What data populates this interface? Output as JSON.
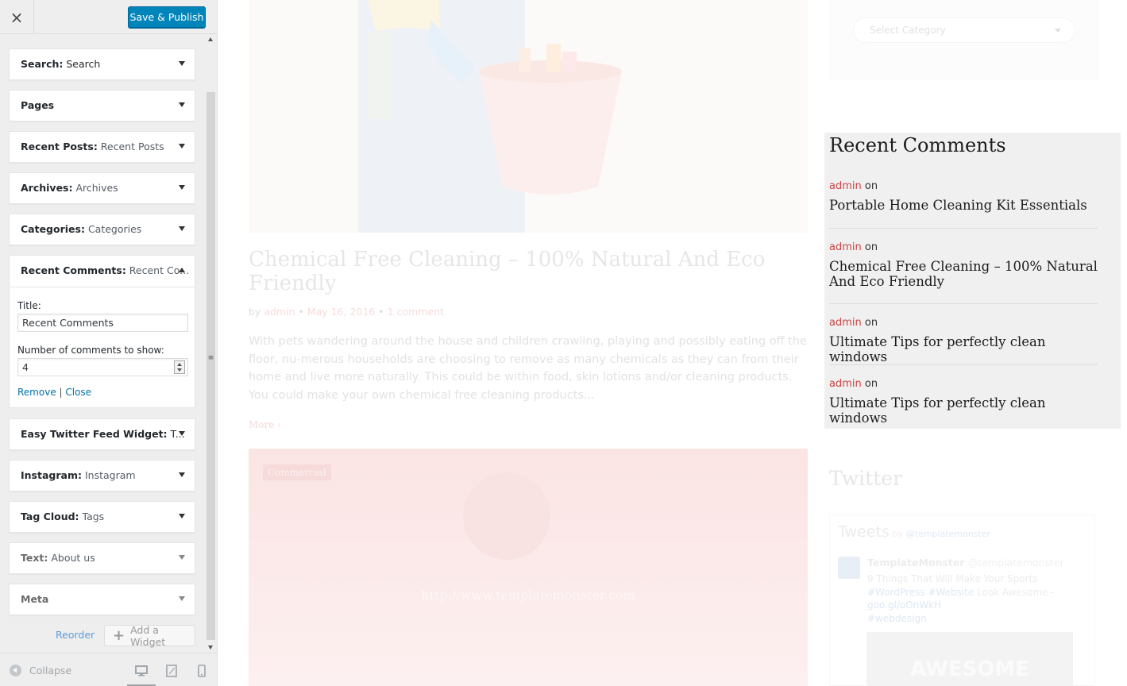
{
  "sidebar": {
    "close_icon": "×",
    "save_label": "Save & Publish",
    "widgets": [
      {
        "title": "Search:",
        "sub": " Search"
      },
      {
        "title": "Pages",
        "sub": ""
      },
      {
        "title": "Recent Posts:",
        "sub": " Recent Posts"
      },
      {
        "title": "Archives:",
        "sub": " Archives"
      },
      {
        "title": "Categories:",
        "sub": " Categories"
      }
    ],
    "expanded": {
      "title": "Recent Comments:",
      "sub": " Recent Co...",
      "title_label": "Title:",
      "title_value": "Recent Comments",
      "number_label": "Number of comments to show:",
      "number_value": "4",
      "remove_label": "Remove",
      "separator": " | ",
      "close_label": "Close"
    },
    "widgets_after": [
      {
        "title": "Easy Twitter Feed Widget:",
        "sub": " T..."
      },
      {
        "title": "Instagram:",
        "sub": " Instagram"
      },
      {
        "title": "Tag Cloud:",
        "sub": " Tags"
      },
      {
        "title": "Text:",
        "sub": " About us"
      },
      {
        "title": "Meta",
        "sub": ""
      }
    ],
    "reorder_label": "Reorder",
    "add_widget_plus": "+",
    "add_widget_label": "Add a Widget",
    "collapse_label": "Collapse",
    "scroll_grip": "≡"
  },
  "preview": {
    "post_title": "Chemical Free Cleaning – 100% Natural And Eco Friendly",
    "meta_by": "by ",
    "meta_author": "admin",
    "meta_dot": " • ",
    "meta_date": "May 16, 2016",
    "meta_comments": "1 comment",
    "excerpt": "With pets wandering around the house and children crawling, playing and possibly eating off the floor, nu-merous households are choosing to remove as many chemicals as they can from their home and live more naturally. This could be within food, skin lotions and/or cleaning products. You could make your own chemical free cleaning products...",
    "more_label": "More ›",
    "post2_category": "Commercial",
    "post2_url": "http://www.templatemonster.com",
    "category_select": "Select Category",
    "recent_comments": {
      "title": "Recent Comments",
      "on": " on",
      "items": [
        {
          "author": "admin",
          "post": "Portable Home Cleaning Kit Essentials"
        },
        {
          "author": "admin",
          "post": "Chemical Free Cleaning – 100% Natural And Eco Friendly"
        },
        {
          "author": "admin",
          "post": "Ultimate Tips for perfectly clean windows"
        },
        {
          "author": "admin",
          "post": "Ultimate Tips for perfectly clean windows"
        }
      ]
    },
    "twitter": {
      "title": "Twitter",
      "tweets_label": "Tweets",
      "by_label": "by",
      "by_handle": "@templatemonster",
      "name": "TemplateMonster",
      "handle": "@templatemonster",
      "text_plain": "9 Things That Will Make Your Sports ",
      "tag1": "#WordPress",
      "tag2": "#Website",
      "text_plain2": " Look Awesome - ",
      "link": "goo.gl/oOnWkH",
      "tag3": "#webdesign",
      "image_text": "AWESOME"
    }
  },
  "colors": {
    "accent": "#0085ba",
    "author": "#cc4444",
    "link": "#0073aa"
  }
}
